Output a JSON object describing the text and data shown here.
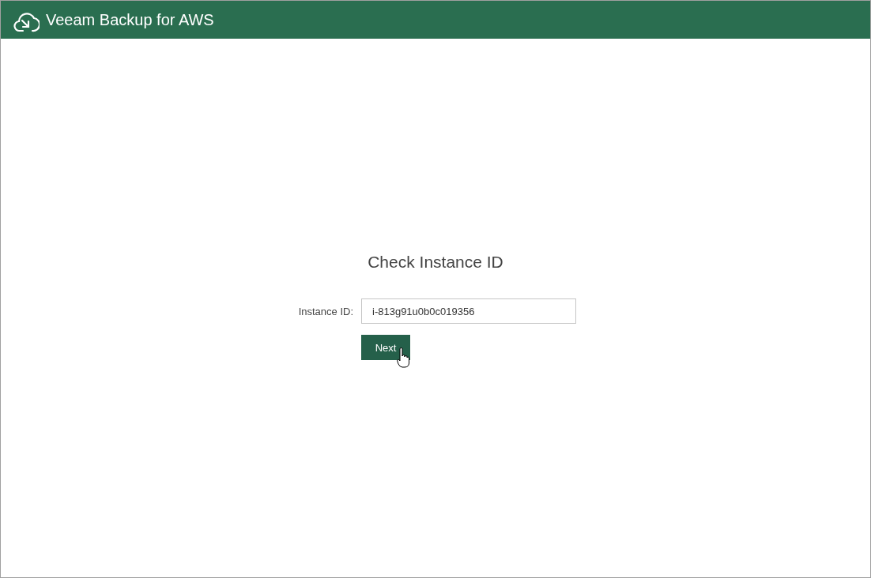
{
  "header": {
    "title": "Veeam Backup for AWS"
  },
  "form": {
    "title": "Check Instance ID",
    "fields": [
      {
        "label": "Instance ID:",
        "value": "i-813g91u0b0c019356"
      }
    ],
    "buttons": [
      {
        "label": "Next"
      }
    ]
  }
}
